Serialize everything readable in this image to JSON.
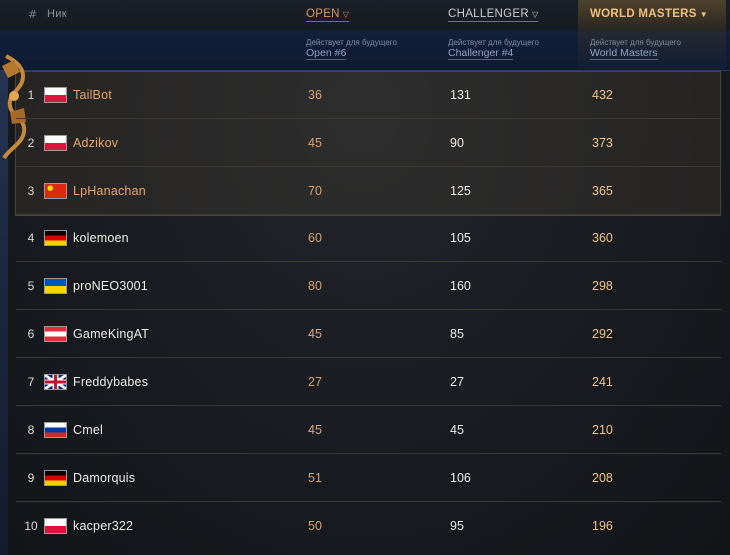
{
  "header": {
    "num_label": "#",
    "nick_label": "Ник",
    "columns": [
      {
        "label": "OPEN",
        "sub_caption": "Действует для будущего",
        "sub_link": "Open #6"
      },
      {
        "label": "CHALLENGER",
        "sub_caption": "Действует для будущего",
        "sub_link": "Challenger #4"
      },
      {
        "label": "WORLD MASTERS",
        "sub_caption": "Действует для будущего",
        "sub_link": "World Masters"
      }
    ]
  },
  "rows": [
    {
      "rank": "1",
      "flag": "poland-flag-icon",
      "name": "TailBot",
      "open": "36",
      "challenger": "131",
      "world_masters": "432"
    },
    {
      "rank": "2",
      "flag": "poland-flag-icon",
      "name": "Adzikov",
      "open": "45",
      "challenger": "90",
      "world_masters": "373"
    },
    {
      "rank": "3",
      "flag": "china-flag-icon",
      "name": "LpHanachan",
      "open": "70",
      "challenger": "125",
      "world_masters": "365"
    },
    {
      "rank": "4",
      "flag": "germany-flag-icon",
      "name": "kolemoen",
      "open": "60",
      "challenger": "105",
      "world_masters": "360"
    },
    {
      "rank": "5",
      "flag": "ukraine-flag-icon",
      "name": "proNEO3001",
      "open": "80",
      "challenger": "160",
      "world_masters": "298"
    },
    {
      "rank": "6",
      "flag": "austria-flag-icon",
      "name": "GameKingAT",
      "open": "45",
      "challenger": "85",
      "world_masters": "292"
    },
    {
      "rank": "7",
      "flag": "uk-flag-icon",
      "name": "Freddybabes",
      "open": "27",
      "challenger": "27",
      "world_masters": "241"
    },
    {
      "rank": "8",
      "flag": "russia-flag-icon",
      "name": "Cmel",
      "open": "45",
      "challenger": "45",
      "world_masters": "210"
    },
    {
      "rank": "9",
      "flag": "germany-flag-icon",
      "name": "Damorquis",
      "open": "51",
      "challenger": "106",
      "world_masters": "208"
    },
    {
      "rank": "10",
      "flag": "poland-flag-icon",
      "name": "kacper322",
      "open": "50",
      "challenger": "95",
      "world_masters": "196"
    }
  ],
  "colors": {
    "accent_orange": "#e9a561",
    "accent_gold": "#f2c489",
    "subheader_blue": "#12203b"
  }
}
